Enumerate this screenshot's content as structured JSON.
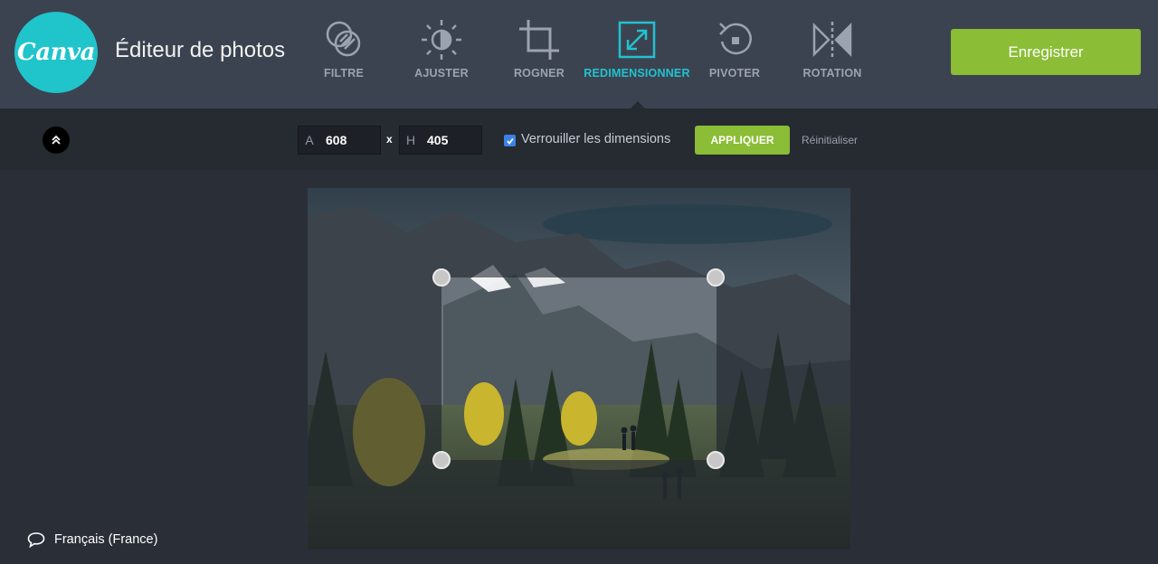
{
  "app": {
    "logo_text": "Canva",
    "title": "Éditeur de photos",
    "save_label": "Enregistrer"
  },
  "tools": [
    {
      "label": "FILTRE",
      "icon": "filter-icon",
      "active": false
    },
    {
      "label": "AJUSTER",
      "icon": "adjust-icon",
      "active": false
    },
    {
      "label": "ROGNER",
      "icon": "crop-icon",
      "active": false
    },
    {
      "label": "REDIMENSIONNER",
      "icon": "resize-icon",
      "active": true
    },
    {
      "label": "PIVOTER",
      "icon": "rotate-icon",
      "active": false
    },
    {
      "label": "ROTATION",
      "icon": "flip-icon",
      "active": false
    }
  ],
  "resize": {
    "width_prefix": "A",
    "width_value": "608",
    "times": "x",
    "height_prefix": "H",
    "height_value": "405",
    "lock_label": "Verrouiller les dimensions",
    "lock_checked": true,
    "apply_label": "APPLIQUER",
    "reset_label": "Réinitialiser"
  },
  "footer": {
    "language": "Français (France)"
  },
  "colors": {
    "accent": "#22c2d0",
    "brand": "#20c4cb",
    "primary_button": "#8bbd36",
    "header_bg": "#3c4350",
    "toolbar_bg": "#262a31",
    "canvas_bg": "#2a2f37"
  }
}
